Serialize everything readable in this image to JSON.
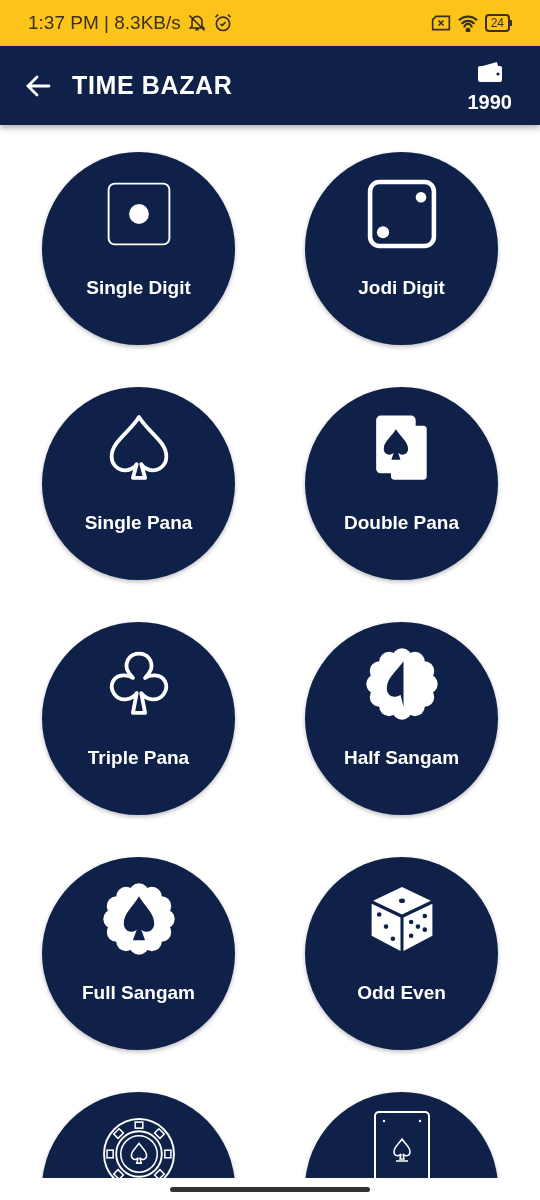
{
  "status_bar": {
    "time": "1:37 PM | 8.3KB/s",
    "battery": "24"
  },
  "header": {
    "title": "TIME BAZAR",
    "wallet_balance": "1990"
  },
  "games": [
    {
      "kind": "die-one",
      "label": "Single Digit"
    },
    {
      "kind": "die-two",
      "label": "Jodi Digit"
    },
    {
      "kind": "spade",
      "label": "Single Pana"
    },
    {
      "kind": "cards",
      "label": "Double Pana"
    },
    {
      "kind": "club",
      "label": "Triple Pana"
    },
    {
      "kind": "half-badge",
      "label": "Half Sangam"
    },
    {
      "kind": "full-badge",
      "label": "Full Sangam"
    },
    {
      "kind": "dice",
      "label": "Odd Even"
    },
    {
      "kind": "chip"
    },
    {
      "kind": "card"
    }
  ]
}
